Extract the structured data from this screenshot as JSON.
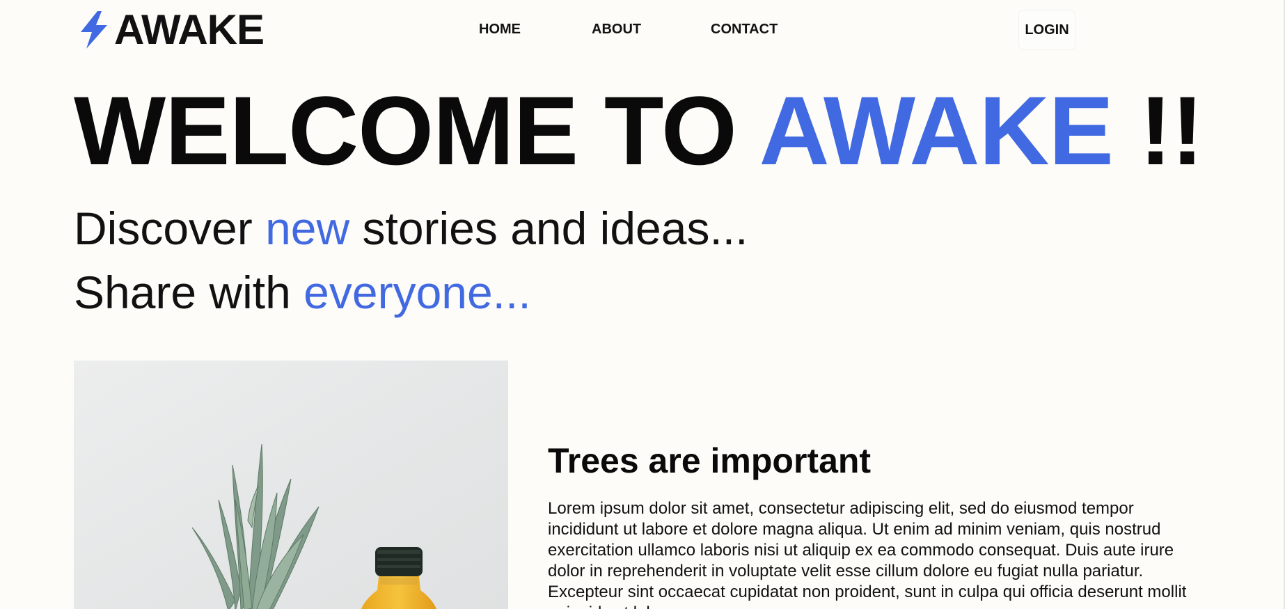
{
  "brand": {
    "name": "AWAKE",
    "accent_color": "#4169e1",
    "icon": "lightning-bolt-icon"
  },
  "nav": {
    "items": [
      {
        "label": "HOME"
      },
      {
        "label": "ABOUT"
      },
      {
        "label": "CONTACT"
      }
    ],
    "login_label": "LOGIN"
  },
  "hero": {
    "title_prefix": "WELCOME TO ",
    "title_accent": "AWAKE",
    "title_suffix": " !!",
    "line1_prefix": "Discover ",
    "line1_accent": "new",
    "line1_suffix": " stories and ideas...",
    "line2_prefix": "Share with ",
    "line2_accent": "everyone..."
  },
  "article": {
    "title": "Trees are important",
    "body": "Lorem ipsum dolor sit amet, consectetur adipiscing elit, sed do eiusmod tempor incididunt ut labore et dolore magna aliqua. Ut enim ad minim veniam, quis nostrud exercitation ullamco laboris nisi ut aliquip ex ea commodo consequat. Duis aute irure dolor in reprehenderit in voluptate velit esse cillum dolore eu fugiat nulla pariatur. Excepteur sint occaecat cupidatat non proident, sunt in culpa qui officia deserunt mollit anim id est laborum.",
    "image": "pineapple-and-juice-bottle-photo"
  }
}
